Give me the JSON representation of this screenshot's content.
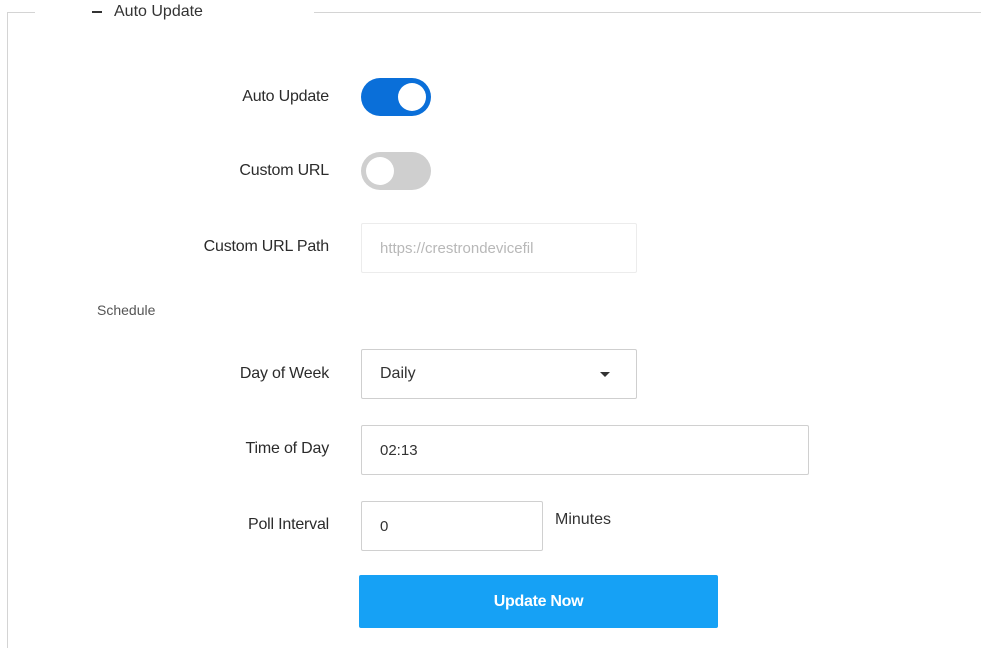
{
  "section": {
    "title": "Auto Update",
    "collapse_symbol": "−"
  },
  "fields": {
    "auto_update": {
      "label": "Auto Update",
      "enabled": true
    },
    "custom_url": {
      "label": "Custom URL",
      "enabled": false
    },
    "custom_url_path": {
      "label": "Custom URL Path",
      "value": "https://crestrondevicefil"
    }
  },
  "schedule": {
    "heading": "Schedule",
    "day_of_week": {
      "label": "Day of Week",
      "selected": "Daily"
    },
    "time_of_day": {
      "label": "Time of Day",
      "value": "02:13"
    },
    "poll_interval": {
      "label": "Poll Interval",
      "value": "0",
      "unit": "Minutes"
    }
  },
  "actions": {
    "update_now_label": "Update Now"
  },
  "icons": {
    "collapse": "minus-icon",
    "select_caret": "caret-down-icon"
  },
  "colors": {
    "toggle_on": "#0a6fd9",
    "toggle_off": "#cfcfcf",
    "primary_button": "#16a1f5"
  }
}
